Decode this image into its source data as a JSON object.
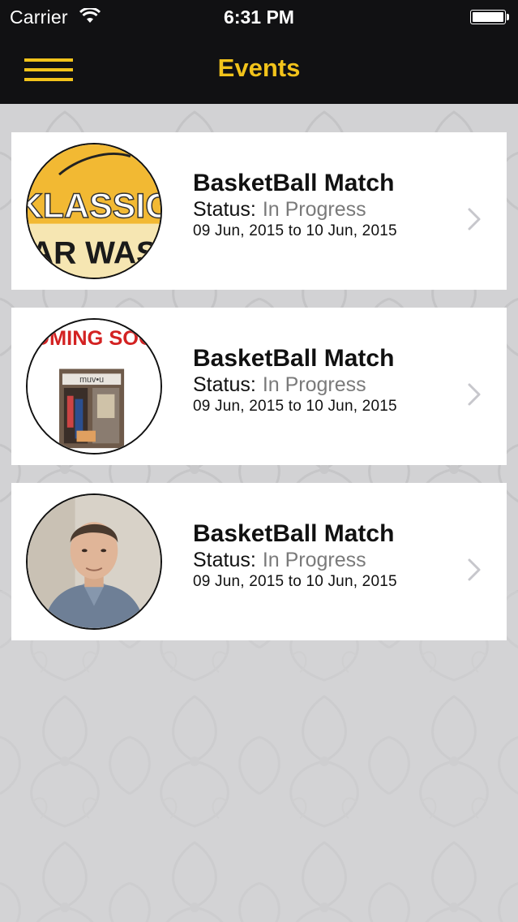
{
  "status_bar": {
    "carrier": "Carrier",
    "time": "6:31 PM",
    "wifi_icon": "wifi-icon",
    "battery_icon": "battery-icon"
  },
  "nav": {
    "title": "Events",
    "menu_icon": "hamburger-menu-icon",
    "accent_color": "#f2c31b",
    "bar_color": "#111113"
  },
  "events": [
    {
      "title": "BasketBall Match",
      "status_label": "Status:",
      "status_value": "In Progress",
      "dates": "09 Jun, 2015 to 10 Jun, 2015",
      "image": "klassic-car-wash-logo",
      "logo_text_line1": "KLASSIC",
      "logo_text_line2": "CAR WASH"
    },
    {
      "title": "BasketBall Match",
      "status_label": "Status:",
      "status_value": "In Progress",
      "dates": "09 Jun, 2015 to 10 Jun, 2015",
      "image": "coming-soon-storefront",
      "banner_text": "COMING SOON",
      "store_sign": "muv•u"
    },
    {
      "title": "BasketBall Match",
      "status_label": "Status:",
      "status_value": "In Progress",
      "dates": "09 Jun, 2015 to 10 Jun, 2015",
      "image": "man-portrait-photo"
    }
  ]
}
